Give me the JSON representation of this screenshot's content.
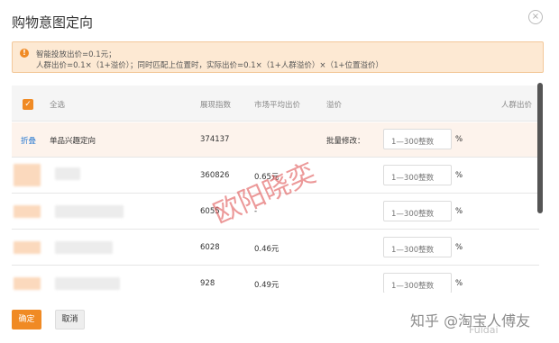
{
  "dialog": {
    "title": "购物意图定向",
    "close_glyph": "×"
  },
  "notice": {
    "icon_glyph": "!",
    "line1": "智能投放出价=0.1元；",
    "line2": "人群出价=0.1×（1+溢价）；同时匹配上位置时，实际出价=0.1×（1+人群溢价）×（1+位置溢价）"
  },
  "table": {
    "select_all_glyph": "✓",
    "headers": {
      "select_all": "全选",
      "impression_index": "展现指数",
      "market_avg_bid": "市场平均出价",
      "premium": "溢价",
      "crowd_price": "人群出价"
    },
    "group_row": {
      "fold_label": "折叠",
      "name": "单品兴趣定向",
      "impression_index": "374137",
      "batch_edit_label": "批量修改：",
      "input_placeholder": "1—300整数",
      "unit": "%"
    },
    "rows": [
      {
        "impression_index": "360826",
        "market_avg_bid": "0.65元",
        "input_placeholder": "1—300整数",
        "unit": "%"
      },
      {
        "impression_index": "6055",
        "market_avg_bid": "-",
        "input_placeholder": "1—300整数",
        "unit": "%"
      },
      {
        "impression_index": "6028",
        "market_avg_bid": "0.46元",
        "input_placeholder": "1—300整数",
        "unit": "%"
      },
      {
        "impression_index": "928",
        "market_avg_bid": "0.49元",
        "input_placeholder": "1—300整数",
        "unit": "%"
      }
    ]
  },
  "watermark": "欧阳晓奕",
  "footer": {
    "ok_label": "确定",
    "cancel_label": "取消"
  },
  "brand": {
    "text": "知乎 @淘宝人傅友",
    "sub": "Fuidai"
  },
  "colors": {
    "accent": "#f08a24",
    "notice_bg": "#fde9d3",
    "link": "#2a7bd1"
  }
}
